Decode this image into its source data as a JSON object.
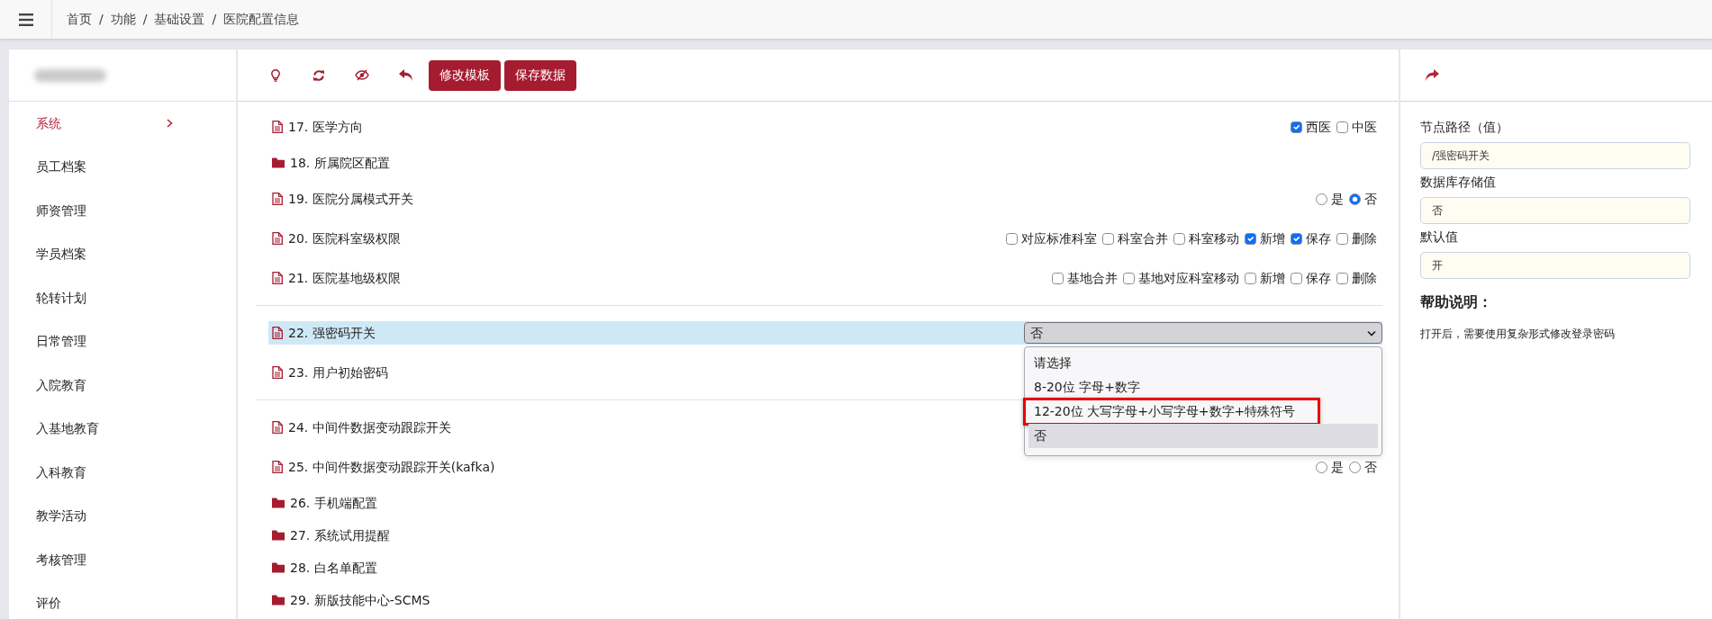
{
  "topbar": {
    "breadcrumb": [
      "首页",
      "功能",
      "基础设置",
      "医院配置信息"
    ],
    "separator": "/"
  },
  "sidebar": {
    "items": [
      {
        "label": "系统",
        "selected": true
      },
      {
        "label": "员工档案",
        "selected": false
      },
      {
        "label": "师资管理",
        "selected": false
      },
      {
        "label": "学员档案",
        "selected": false
      },
      {
        "label": "轮转计划",
        "selected": false
      },
      {
        "label": "日常管理",
        "selected": false
      },
      {
        "label": "入院教育",
        "selected": false
      },
      {
        "label": "入基地教育",
        "selected": false
      },
      {
        "label": "入科教育",
        "selected": false
      },
      {
        "label": "教学活动",
        "selected": false
      },
      {
        "label": "考核管理",
        "selected": false
      },
      {
        "label": "评价",
        "selected": false
      }
    ]
  },
  "toolbar": {
    "buttons": [
      {
        "label": "修改模板"
      },
      {
        "label": "保存数据"
      }
    ]
  },
  "sections": [
    {
      "items": [
        {
          "label": "17. 医学方向",
          "kind": "file",
          "selected": false,
          "control": {
            "kind": "checkboxes",
            "options": [
              {
                "label": "西医",
                "checked": true
              },
              {
                "label": "中医",
                "checked": false
              }
            ]
          }
        },
        {
          "label": "18. 所属院区配置",
          "kind": "folder",
          "selected": false
        },
        {
          "label": "19. 医院分属模式开关",
          "kind": "file",
          "selected": false,
          "control": {
            "kind": "radios",
            "options": [
              {
                "label": "是",
                "checked": false
              },
              {
                "label": "否",
                "checked": true
              }
            ]
          }
        },
        {
          "label": "20. 医院科室级权限",
          "kind": "file",
          "selected": false,
          "control": {
            "kind": "checkboxes",
            "options": [
              {
                "label": "对应标准科室",
                "checked": false
              },
              {
                "label": "科室合并",
                "checked": false
              },
              {
                "label": "科室移动",
                "checked": false
              },
              {
                "label": "新增",
                "checked": true
              },
              {
                "label": "保存",
                "checked": true
              },
              {
                "label": "删除",
                "checked": false
              }
            ]
          }
        },
        {
          "label": "21. 医院基地级权限",
          "kind": "file",
          "selected": false,
          "control": {
            "kind": "checkboxes",
            "options": [
              {
                "label": "基地合并",
                "checked": false
              },
              {
                "label": "基地对应科室移动",
                "checked": false
              },
              {
                "label": "新增",
                "checked": false
              },
              {
                "label": "保存",
                "checked": false
              },
              {
                "label": "删除",
                "checked": false
              }
            ]
          }
        }
      ]
    },
    {
      "items": [
        {
          "label": "22. 强密码开关",
          "kind": "file",
          "selected": true,
          "control": {
            "kind": "select",
            "value": "否",
            "expanded": true,
            "options": [
              {
                "label": "请选择",
                "selected": false,
                "highlighted": false
              },
              {
                "label": "8-20位 字母+数字",
                "selected": false,
                "highlighted": false
              },
              {
                "label": "12-20位 大写字母+小写字母+数字+特殊符号",
                "selected": false,
                "highlighted": true
              },
              {
                "label": "否",
                "selected": true,
                "highlighted": false
              }
            ]
          }
        },
        {
          "label": "23. 用户初始密码",
          "kind": "file",
          "selected": false
        }
      ]
    },
    {
      "items": [
        {
          "label": "24. 中间件数据变动跟踪开关",
          "kind": "file",
          "selected": false
        },
        {
          "label": "25. 中间件数据变动跟踪开关(kafka)",
          "kind": "file",
          "selected": false,
          "control": {
            "kind": "radios",
            "options": [
              {
                "label": "是",
                "checked": false
              },
              {
                "label": "否",
                "checked": false
              }
            ]
          }
        },
        {
          "label": "26. 手机端配置",
          "kind": "folder",
          "selected": false
        },
        {
          "label": "27. 系统试用提醒",
          "kind": "folder",
          "selected": false
        },
        {
          "label": "28. 白名单配置",
          "kind": "folder",
          "selected": false
        },
        {
          "label": "29. 新版技能中心-SCMS",
          "kind": "folder",
          "selected": false
        }
      ]
    }
  ],
  "detail": {
    "fields": [
      {
        "label": "节点路径（值）",
        "value": "/强密码开关"
      },
      {
        "label": "数据库存储值",
        "value": "否"
      },
      {
        "label": "默认值",
        "value": "开"
      }
    ],
    "help_title": "帮助说明：",
    "help_text": "打开后，需要使用复杂形式修改登录密码"
  }
}
